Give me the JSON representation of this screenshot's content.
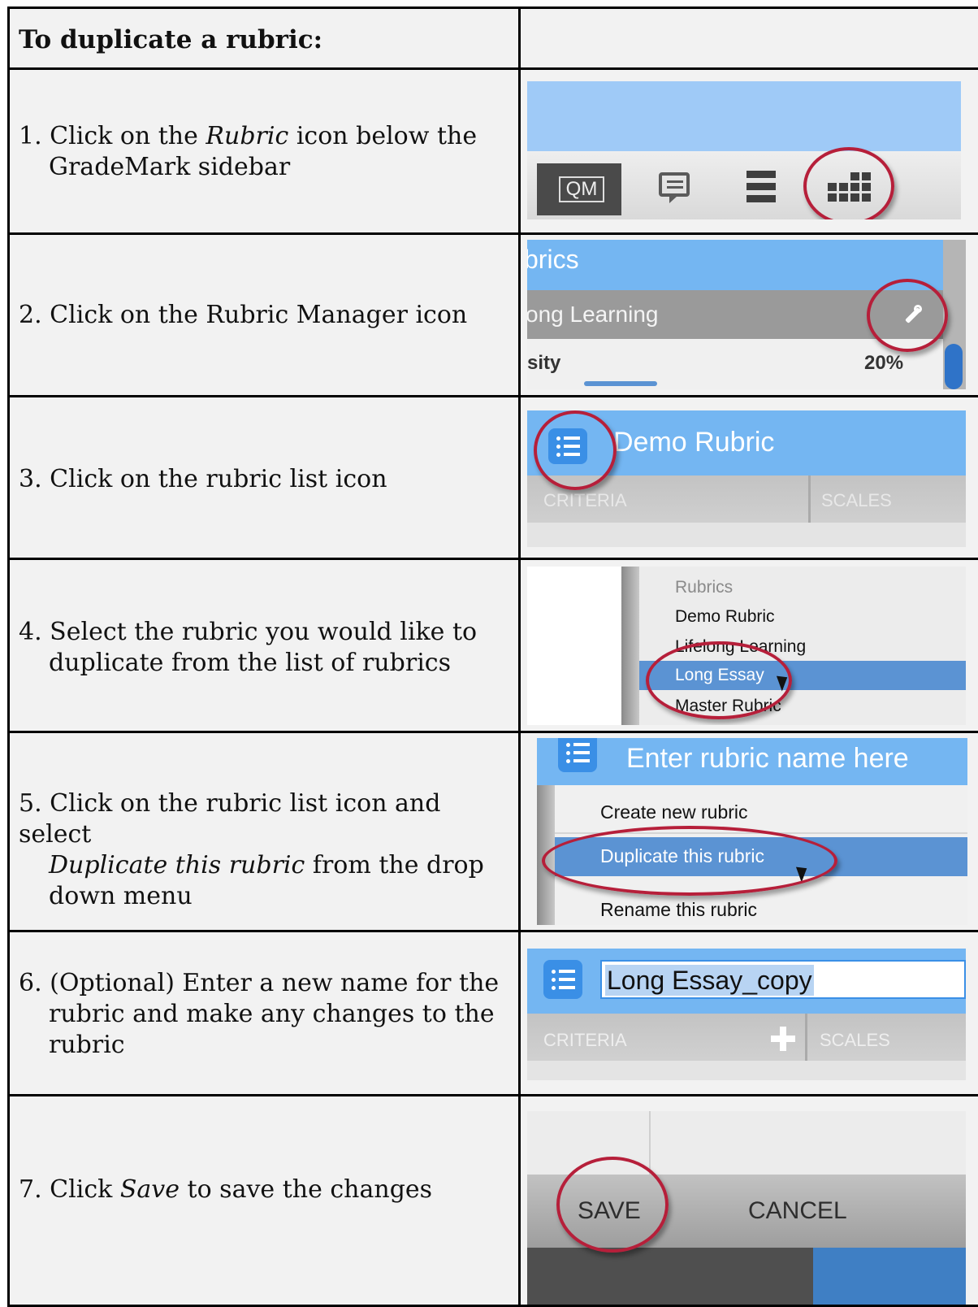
{
  "header": {
    "title": "To duplicate a rubric:"
  },
  "steps": [
    {
      "number": "1.",
      "line1_a": "Click on the ",
      "line1_em": "Rubric",
      "line1_b": " icon below the",
      "line2": "GradeMark sidebar"
    },
    {
      "number": "2.",
      "line1": "Click on the Rubric Manager icon"
    },
    {
      "number": "3.",
      "line1": "Click on the rubric list icon"
    },
    {
      "number": "4.",
      "line1": "Select the rubric you would like to",
      "line2": "duplicate from the list of rubrics"
    },
    {
      "number": "5.",
      "line1": "Click on the rubric list icon and select",
      "line2_em": "Duplicate this rubric",
      "line2_b": " from the drop",
      "line3": "down menu"
    },
    {
      "number": "6.",
      "line1": "(Optional) Enter a new name for the",
      "line2": "rubric and make any changes to the",
      "line3": "rubric"
    },
    {
      "number": "7.",
      "line1_a": "Click ",
      "line1_em": "Save",
      "line1_b": " to save the changes"
    }
  ],
  "shots": {
    "s1": {
      "qm_label": "QM"
    },
    "s2": {
      "title_fragment": "brics",
      "row_label": "ong Learning",
      "sub_label": "sity",
      "percent": "20%"
    },
    "s3": {
      "title": "Demo Rubric",
      "col1": "CRITERIA",
      "col2": "SCALES"
    },
    "s4": {
      "heading": "Rubrics",
      "items": [
        "Demo Rubric",
        "Lifelong Learning",
        "Long Essay",
        "Master Rubric"
      ],
      "selected": "Long Essay"
    },
    "s5": {
      "title": "Enter rubric name here",
      "menu": [
        "Create new rubric",
        "Duplicate this rubric",
        "Rename this rubric"
      ]
    },
    "s6": {
      "name_value": "Long Essay_copy",
      "col1": "CRITERIA",
      "col2": "SCALES"
    },
    "s7": {
      "save": "SAVE",
      "cancel": "CANCEL"
    }
  },
  "colors": {
    "accent_blue": "#74b6f2",
    "highlight_circle": "#b61f3a",
    "selection_blue": "#5b93d3"
  }
}
